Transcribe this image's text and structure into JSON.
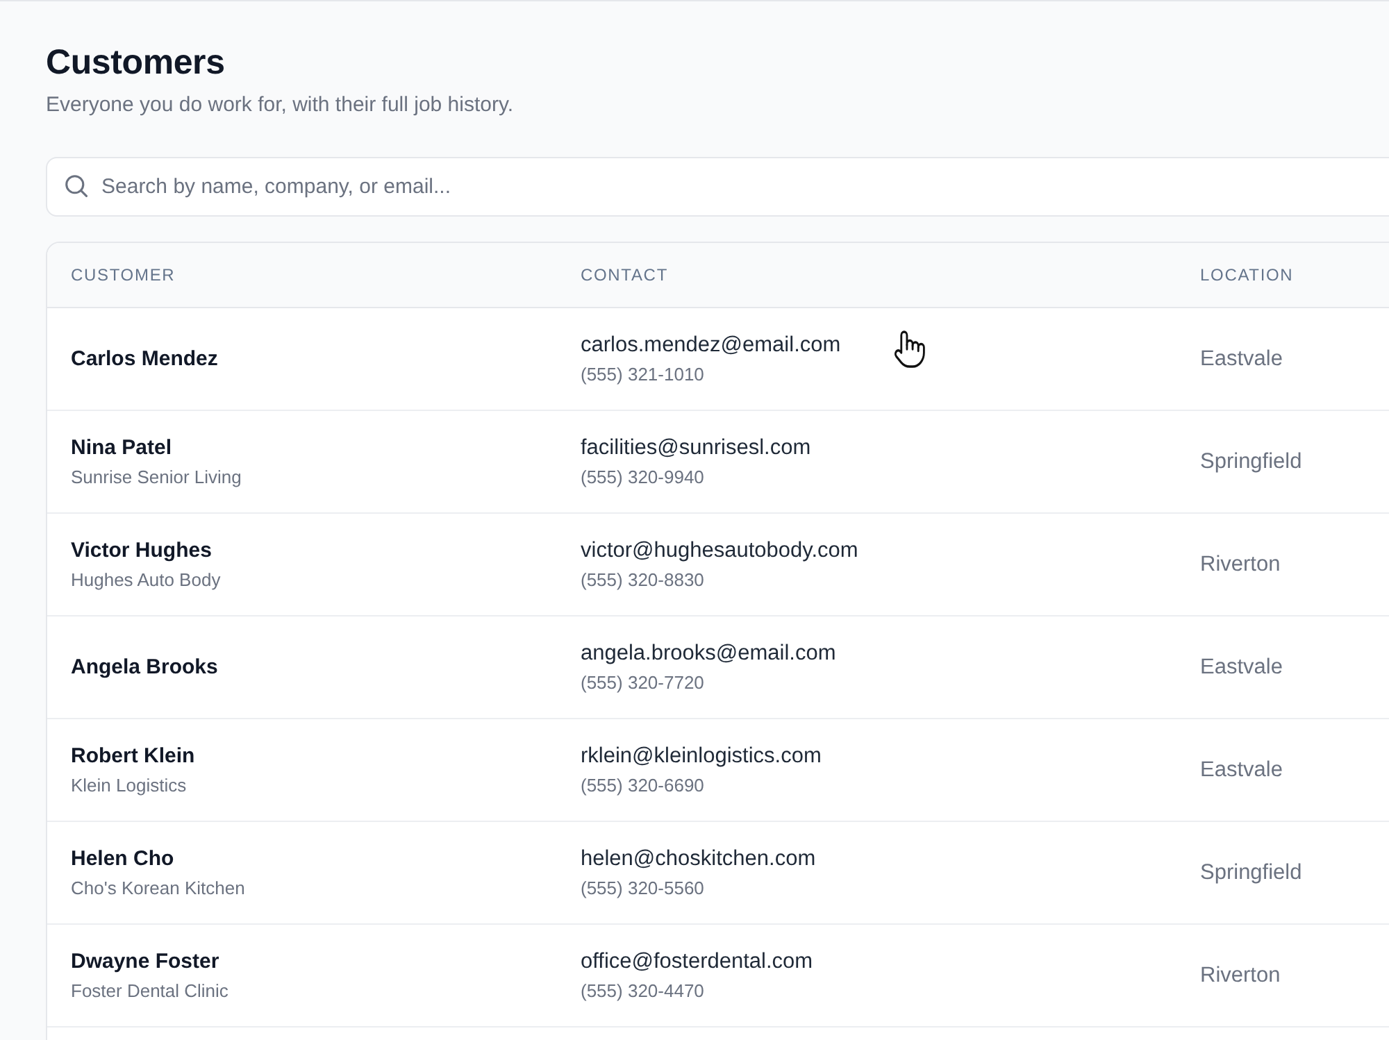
{
  "page": {
    "title": "Customers",
    "subtitle": "Everyone you do work for, with their full job history."
  },
  "search": {
    "placeholder": "Search by name, company, or email..."
  },
  "table": {
    "columns": [
      "CUSTOMER",
      "CONTACT",
      "LOCATION"
    ],
    "rows": [
      {
        "name": "Carlos Mendez",
        "email": "carlos.mendez@email.com",
        "phone": "(555) 321-1010",
        "location": "Eastvale"
      },
      {
        "name": "Nina Patel",
        "company": "Sunrise Senior Living",
        "email": "facilities@sunrisesl.com",
        "phone": "(555) 320-9940",
        "location": "Springfield"
      },
      {
        "name": "Victor Hughes",
        "company": "Hughes Auto Body",
        "email": "victor@hughesautobody.com",
        "phone": "(555) 320-8830",
        "location": "Riverton"
      },
      {
        "name": "Angela Brooks",
        "email": "angela.brooks@email.com",
        "phone": "(555) 320-7720",
        "location": "Eastvale"
      },
      {
        "name": "Robert Klein",
        "company": "Klein Logistics",
        "email": "rklein@kleinlogistics.com",
        "phone": "(555) 320-6690",
        "location": "Eastvale"
      },
      {
        "name": "Helen Cho",
        "company": "Cho's Korean Kitchen",
        "email": "helen@choskitchen.com",
        "phone": "(555) 320-5560",
        "location": "Springfield"
      },
      {
        "name": "Dwayne Foster",
        "company": "Foster Dental Clinic",
        "email": "office@fosterdental.com",
        "phone": "(555) 320-4470",
        "location": "Riverton"
      }
    ]
  }
}
